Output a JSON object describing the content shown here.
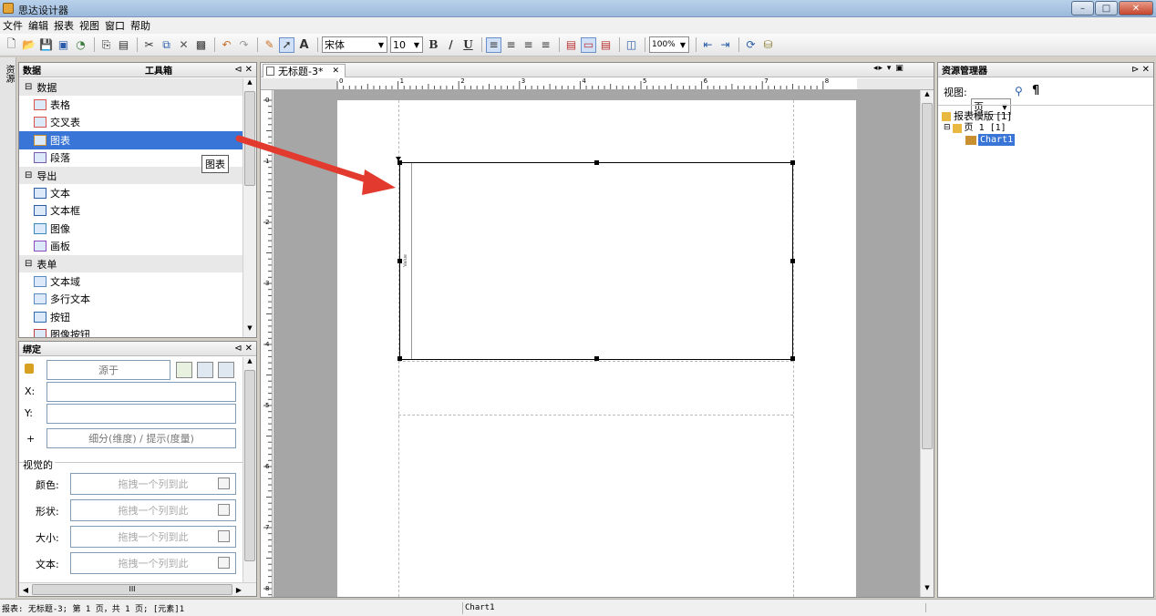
{
  "window": {
    "title": "思达设计器"
  },
  "menu": [
    "文件",
    "编辑",
    "报表",
    "视图",
    "窗口",
    "帮助"
  ],
  "toolbar": {
    "font": "宋体",
    "size": "10",
    "zoom": "100%",
    "text_tool": "A",
    "bold": "B",
    "italic": "/",
    "underline": "U"
  },
  "side_tab": "资源",
  "data_panel": {
    "tab_data": "数据",
    "tab_tools": "工具箱",
    "groups": [
      {
        "label": "数据",
        "items": [
          "表格",
          "交叉表",
          "图表",
          "段落"
        ]
      },
      {
        "label": "导出",
        "items": [
          "文本",
          "文本框",
          "图像",
          "画板"
        ]
      },
      {
        "label": "表单",
        "items": [
          "文本域",
          "多行文本",
          "按钮",
          "图像按钮"
        ]
      }
    ],
    "tooltip": "图表"
  },
  "binding_panel": {
    "title": "绑定",
    "source": "源于",
    "x_label": "X:",
    "y_label": "Y:",
    "plus_label": "+",
    "detail": "细分(维度) / 提示(度量)",
    "visual_title": "视觉的",
    "visual_rows": [
      {
        "label": "颜色:",
        "placeholder": "拖拽一个列到此"
      },
      {
        "label": "形状:",
        "placeholder": "拖拽一个列到此"
      },
      {
        "label": "大小:",
        "placeholder": "拖拽一个列到此"
      },
      {
        "label": "文本:",
        "placeholder": "拖拽一个列到此"
      }
    ],
    "hscroll_mid": "III"
  },
  "document": {
    "tab": "无标题-3*",
    "ruler_top": [
      "0",
      "1",
      "2",
      "3",
      "4",
      "5",
      "6",
      "7",
      "8"
    ],
    "ruler_left": [
      "0",
      "1",
      "2",
      "3",
      "4",
      "5",
      "6",
      "7",
      "8"
    ],
    "chart_ylabel": "Value"
  },
  "resource_panel": {
    "title": "资源管理器",
    "view_label": "视图:",
    "view_value": "页",
    "tree": [
      {
        "label": "报表模版 [1]"
      },
      {
        "label": "页 1  [1]"
      },
      {
        "label": "Chart1"
      }
    ]
  },
  "status": {
    "left": "报表: 无标题-3; 第 1 页，共 1 页; [元素]1",
    "middle": "Chart1"
  }
}
